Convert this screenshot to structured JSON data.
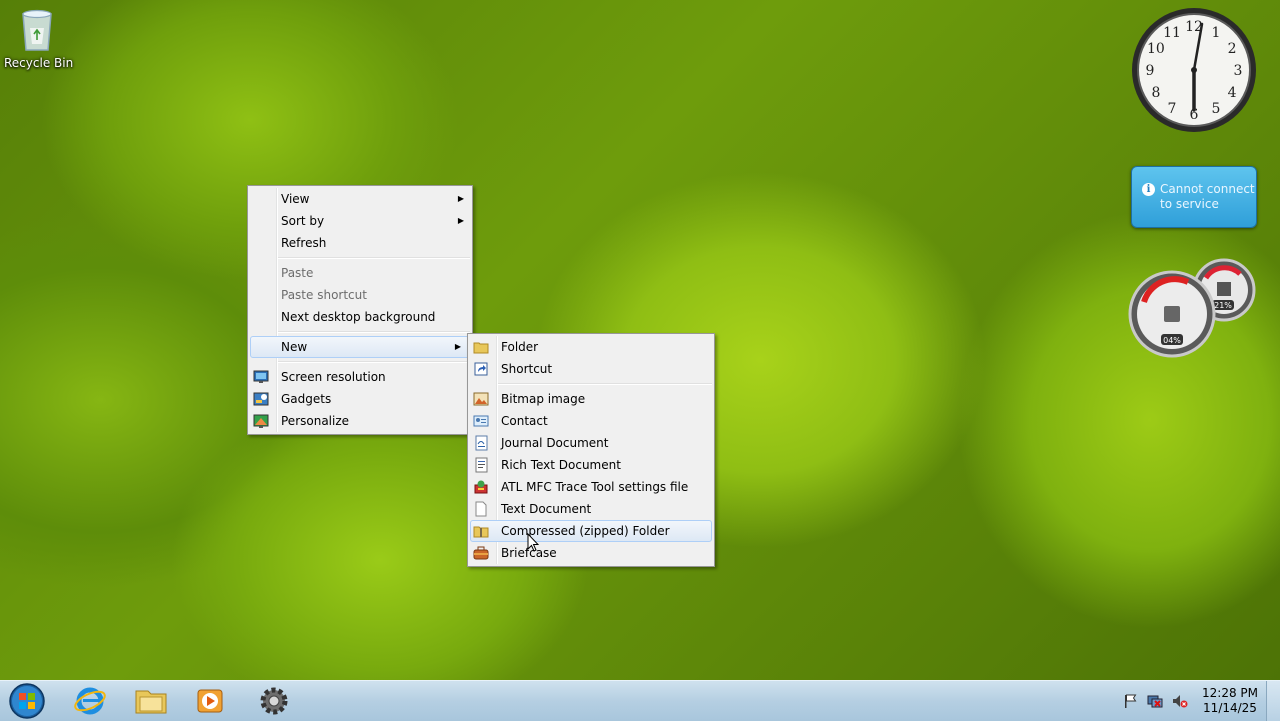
{
  "desktop": {
    "icons": [
      {
        "label": "Recycle Bin",
        "icon": "recycle-bin-icon"
      }
    ]
  },
  "gadgets": {
    "clock": {
      "numerals": [
        "12",
        "1",
        "2",
        "3",
        "4",
        "5",
        "6",
        "7",
        "8",
        "9",
        "10",
        "11"
      ],
      "time_shown": "12:28"
    },
    "weather": {
      "message_line1": "Cannot connect",
      "message_line2": "to service",
      "icon": "info-icon"
    },
    "cpu_meter": {
      "cpu_percent": "04%",
      "memory_percent": "21%"
    }
  },
  "context_menu": {
    "items": [
      {
        "label": "View",
        "submenu": true,
        "enabled": true
      },
      {
        "label": "Sort by",
        "submenu": true,
        "enabled": true
      },
      {
        "label": "Refresh",
        "enabled": true
      },
      {
        "separator": true
      },
      {
        "label": "Paste",
        "enabled": false
      },
      {
        "label": "Paste shortcut",
        "enabled": false
      },
      {
        "label": "Next desktop background",
        "enabled": true
      },
      {
        "separator": true
      },
      {
        "label": "New",
        "submenu": true,
        "enabled": true,
        "highlighted": true
      },
      {
        "separator": true
      },
      {
        "label": "Screen resolution",
        "icon": "screen-resolution-icon",
        "enabled": true
      },
      {
        "label": "Gadgets",
        "icon": "gadgets-icon",
        "enabled": true
      },
      {
        "label": "Personalize",
        "icon": "personalize-icon",
        "enabled": true
      }
    ]
  },
  "new_submenu": {
    "items": [
      {
        "label": "Folder",
        "icon": "folder-icon"
      },
      {
        "label": "Shortcut",
        "icon": "shortcut-icon"
      },
      {
        "separator": true
      },
      {
        "label": "Bitmap image",
        "icon": "bitmap-icon"
      },
      {
        "label": "Contact",
        "icon": "contact-icon"
      },
      {
        "label": "Journal Document",
        "icon": "journal-icon"
      },
      {
        "label": "Rich Text Document",
        "icon": "rich-text-icon"
      },
      {
        "label": "ATL MFC Trace Tool settings file",
        "icon": "trace-tool-icon"
      },
      {
        "label": "Text Document",
        "icon": "text-document-icon"
      },
      {
        "label": "Compressed (zipped) Folder",
        "icon": "zip-folder-icon",
        "highlighted": true
      },
      {
        "label": "Briefcase",
        "icon": "briefcase-icon"
      }
    ]
  },
  "taskbar": {
    "pinned": [
      {
        "name": "Internet Explorer",
        "icon": "internet-explorer-icon"
      },
      {
        "name": "Windows Explorer",
        "icon": "file-explorer-icon"
      },
      {
        "name": "Windows Media Player",
        "icon": "media-player-icon"
      },
      {
        "name": "Settings",
        "icon": "gear-icon"
      }
    ],
    "tray_icons": [
      "action-center-flag-icon",
      "network-icon",
      "volume-muted-icon"
    ],
    "clock": {
      "time": "12:28 PM",
      "date": "11/14/25"
    }
  },
  "colors": {
    "menu_bg": "#f0f0f0",
    "highlight_border": "#aecff7",
    "taskbar": "#b5cfe2",
    "wallpaper_green": "#8fbe14"
  }
}
